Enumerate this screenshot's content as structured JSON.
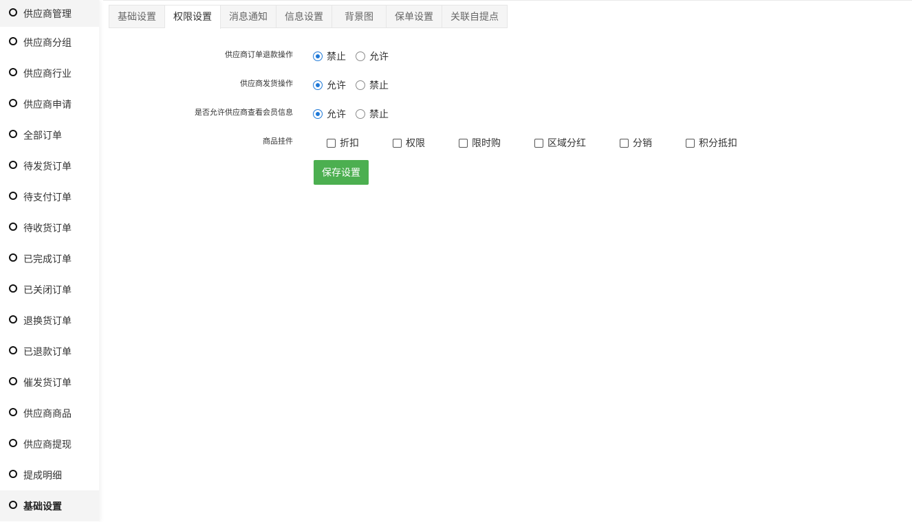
{
  "sidebar": {
    "items": [
      {
        "label": "供应商管理"
      },
      {
        "label": "供应商分组"
      },
      {
        "label": "供应商行业"
      },
      {
        "label": "供应商申请"
      },
      {
        "label": "全部订单"
      },
      {
        "label": "待发货订单"
      },
      {
        "label": "待支付订单"
      },
      {
        "label": "待收货订单"
      },
      {
        "label": "已完成订单"
      },
      {
        "label": "已关闭订单"
      },
      {
        "label": "退换货订单"
      },
      {
        "label": "已退款订单"
      },
      {
        "label": "催发货订单"
      },
      {
        "label": "供应商商品"
      },
      {
        "label": "供应商提现"
      },
      {
        "label": "提成明细"
      },
      {
        "label": "基础设置"
      }
    ],
    "active": "基础设置"
  },
  "tabs": [
    {
      "label": "基础设置"
    },
    {
      "label": "权限设置"
    },
    {
      "label": "消息通知"
    },
    {
      "label": "信息设置"
    },
    {
      "label": "背景图"
    },
    {
      "label": "保单设置"
    },
    {
      "label": "关联自提点"
    }
  ],
  "active_tab": "权限设置",
  "form": {
    "refund": {
      "label": "供应商订单退款操作",
      "opt1": "禁止",
      "opt2": "允许",
      "selected": "禁止"
    },
    "ship": {
      "label": "供应商发货操作",
      "opt1": "允许",
      "opt2": "禁止",
      "selected": "允许"
    },
    "member": {
      "label": "是否允许供应商查看会员信息",
      "opt1": "允许",
      "opt2": "禁止",
      "selected": "允许"
    },
    "plugins": {
      "label": "商品挂件",
      "options": [
        "折扣",
        "权限",
        "限时购",
        "区域分红",
        "分销",
        "积分抵扣"
      ]
    },
    "save_label": "保存设置"
  },
  "colors": {
    "accent": "#1e78d7",
    "save_button": "#4caf50"
  }
}
